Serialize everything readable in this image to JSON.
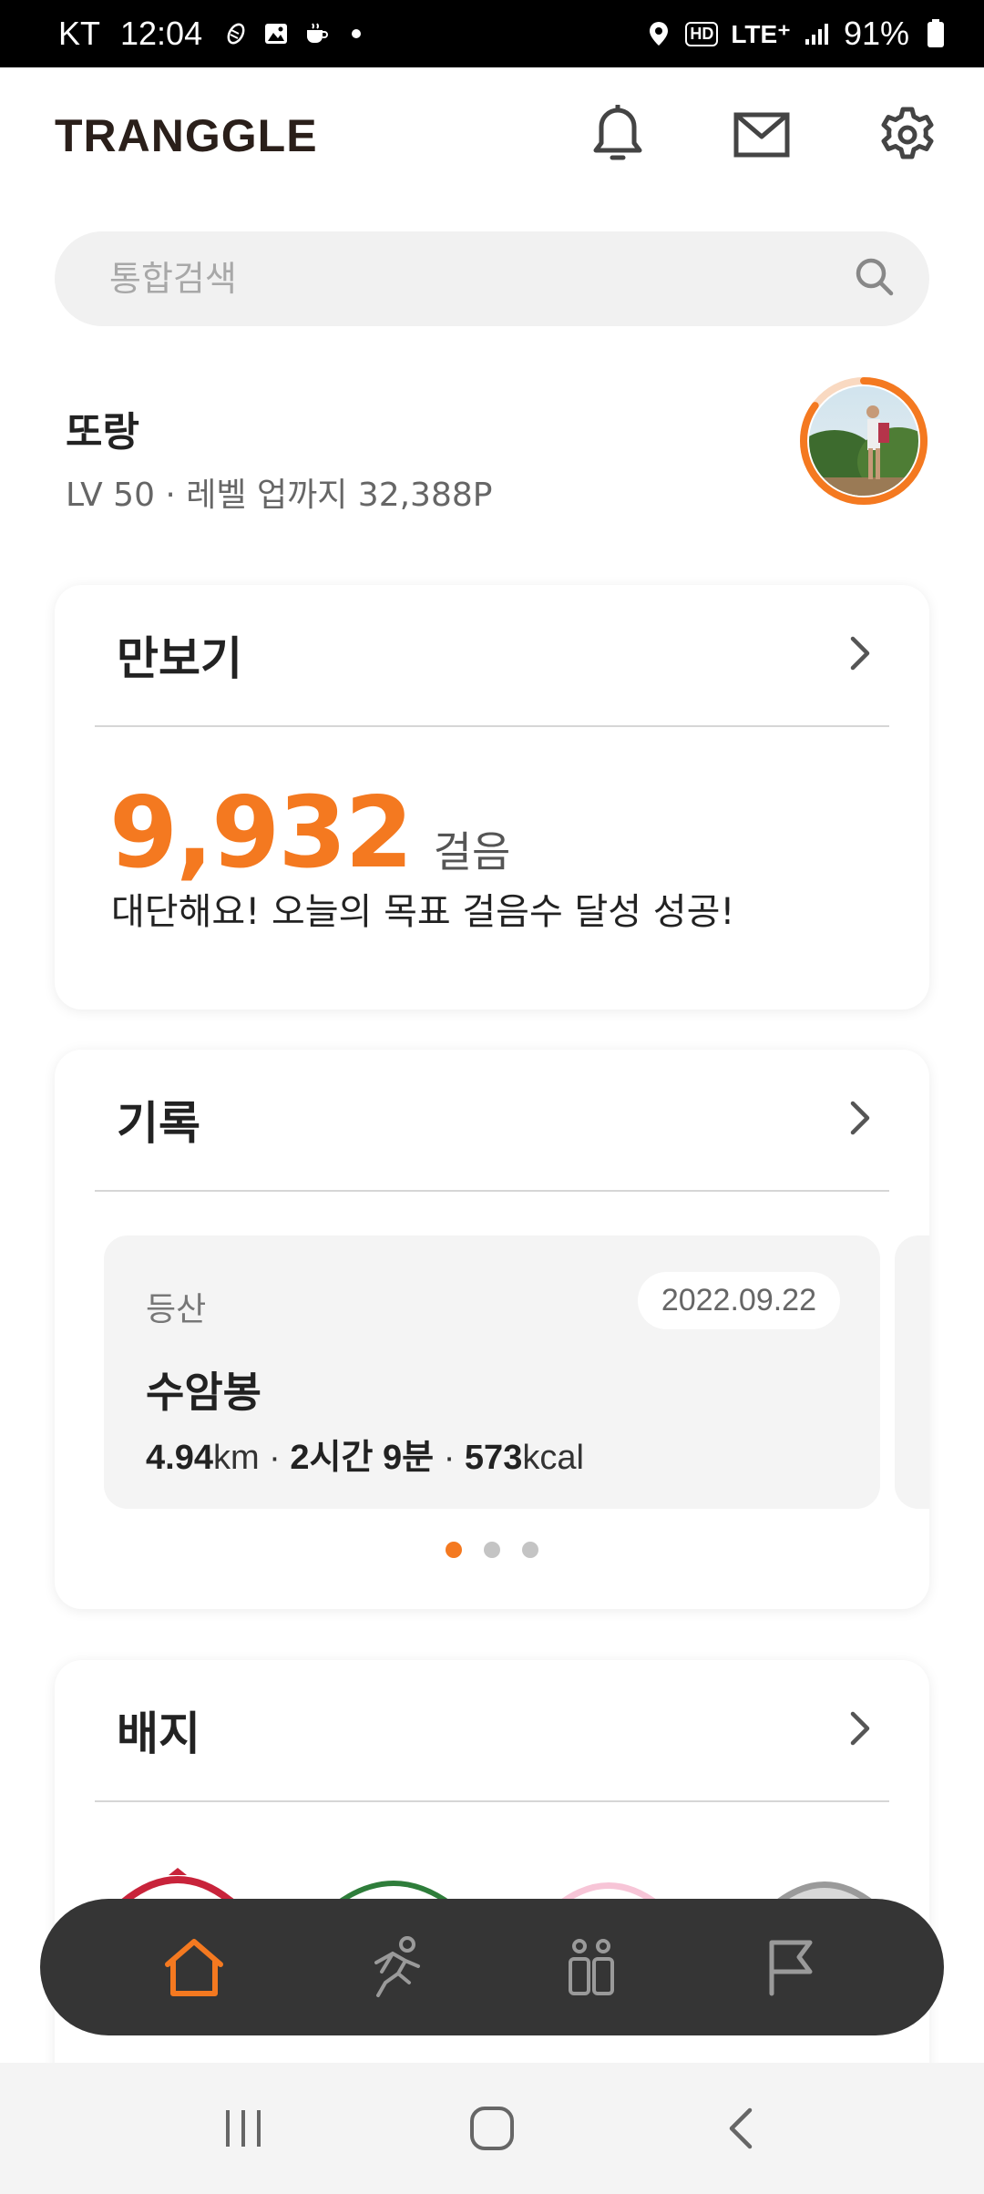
{
  "status_bar": {
    "carrier": "KT",
    "time": "12:04",
    "network": "LTE⁺",
    "battery": "91%",
    "icons": [
      "shoe-print-icon",
      "image-icon",
      "cup-icon",
      "dot-icon",
      "location-icon",
      "hd-icon",
      "signal-icon",
      "battery-icon"
    ]
  },
  "header": {
    "logo": "TRANGGLE",
    "icons": [
      "bell-icon",
      "mail-icon",
      "gear-icon"
    ]
  },
  "search": {
    "placeholder": "통합검색",
    "value": ""
  },
  "profile": {
    "name": "또랑",
    "level_text": "LV 50 · 레벨 업까지 32,388P",
    "level_progress": 0.85
  },
  "pedometer": {
    "title": "만보기",
    "steps": "9,932",
    "unit": "걸음",
    "message": "대단해요! 오늘의 목표 걸음수 달성 성공!"
  },
  "records": {
    "title": "기록",
    "item": {
      "category": "등산",
      "date": "2022.09.22",
      "name": "수암봉",
      "distance": "4.94",
      "distance_unit": "km",
      "duration_h": "2",
      "duration_h_unit": "시간",
      "duration_m": "9",
      "duration_m_unit": "분",
      "calories": "573",
      "calories_unit": "kcal",
      "separator": " · "
    },
    "pagination": {
      "total": 3,
      "active": 1
    }
  },
  "badges": {
    "title": "배지"
  },
  "tabbar": {
    "items": [
      "home-icon",
      "run-icon",
      "people-icon",
      "flag-icon"
    ],
    "active": 0,
    "accent": "#f47920"
  },
  "nav": {
    "items": [
      "recent-apps-icon",
      "home-button-icon",
      "back-icon"
    ]
  },
  "colors": {
    "accent": "#f47920",
    "tabbar_bg": "#353535"
  }
}
